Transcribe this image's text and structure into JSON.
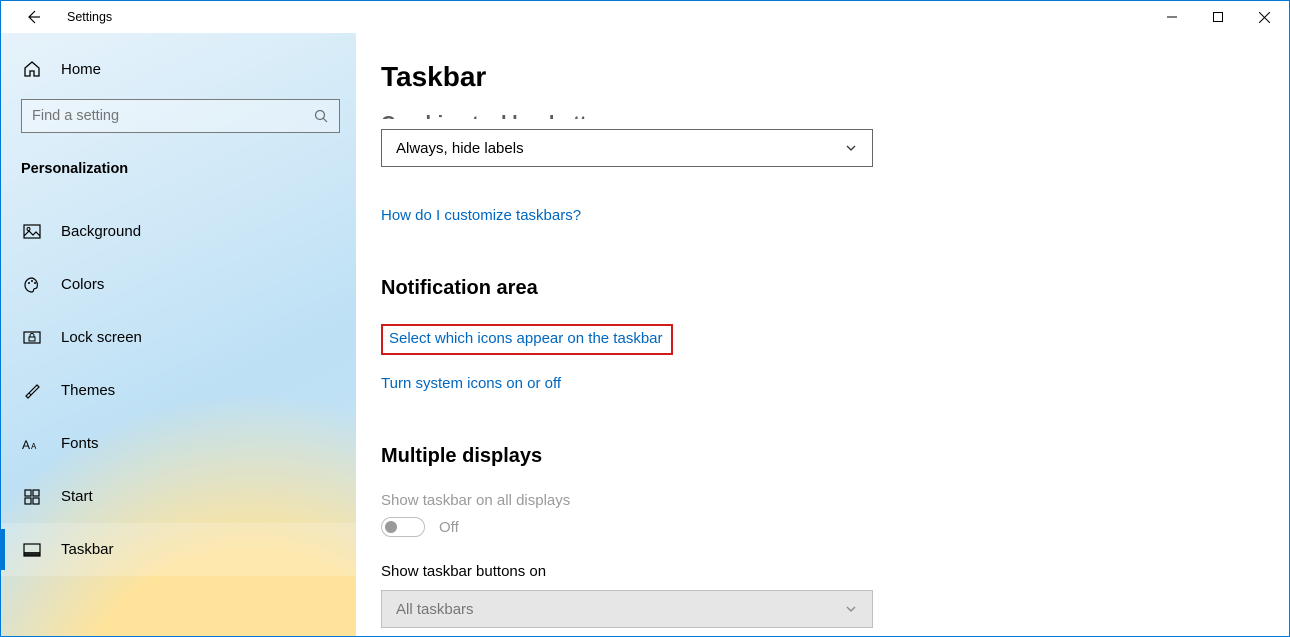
{
  "window": {
    "title": "Settings"
  },
  "sidebar": {
    "home_label": "Home",
    "search_placeholder": "Find a setting",
    "category_label": "Personalization",
    "items": [
      {
        "icon": "image-icon",
        "label": "Background"
      },
      {
        "icon": "palette-icon",
        "label": "Colors"
      },
      {
        "icon": "lock-icon",
        "label": "Lock screen"
      },
      {
        "icon": "brush-icon",
        "label": "Themes"
      },
      {
        "icon": "font-icon",
        "label": "Fonts"
      },
      {
        "icon": "tiles-icon",
        "label": "Start"
      },
      {
        "icon": "taskbar-icon",
        "label": "Taskbar",
        "selected": true
      }
    ]
  },
  "content": {
    "page_title": "Taskbar",
    "cropped_setting_label": "Combine taskbar buttons",
    "combine_dropdown_value": "Always, hide labels",
    "customize_link": "How do I customize taskbars?",
    "sections": {
      "notification": {
        "heading": "Notification area",
        "link_icons": "Select which icons appear on the taskbar",
        "link_system_icons": "Turn system icons on or off"
      },
      "multiple_displays": {
        "heading": "Multiple displays",
        "show_all_label": "Show taskbar on all displays",
        "show_all_state": "Off",
        "buttons_on_label": "Show taskbar buttons on",
        "buttons_on_value": "All taskbars"
      }
    }
  }
}
